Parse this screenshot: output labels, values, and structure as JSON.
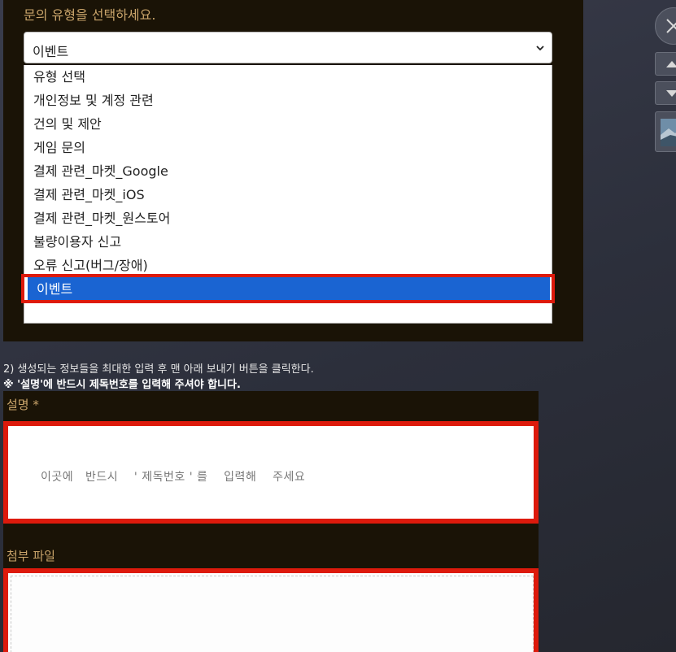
{
  "inquiry": {
    "type_prompt": "문의 유형을 선택하세요.",
    "selected_value": "이벤트",
    "options": [
      "유형 선택",
      "개인정보 및 계정 관련",
      "건의 및 제안",
      "게임 문의",
      "결제 관련_마켓_Google",
      "결제 관련_마켓_iOS",
      "결제 관련_마켓_원스토어",
      "불량이용자 신고",
      "오류 신고(버그/장애)",
      "이벤트"
    ],
    "selected_index": 9
  },
  "instructions": {
    "step2": "2) 생성되는 정보들을 최대한 입력 후 맨 아래 보내기 버튼을 클릭한다.",
    "note": "※ '설명'에 반드시 제독번호를 입력해 주셔야 합니다."
  },
  "form": {
    "description_label": "설명 *",
    "description_placeholder": "이곳에   반드시    ' 제독번호 ' 를    입력해    주세요",
    "attachment_label": "첨부 파일"
  },
  "colors": {
    "panel": "#1a1306",
    "label": "#c9a46a",
    "highlight": "#dd1a0c",
    "selected": "#1a64d2"
  },
  "icons": {
    "close": "close-icon",
    "up": "arrow-up-icon",
    "down": "arrow-down-icon",
    "dropdown": "chevron-down-icon",
    "thumbnail": "image-thumbnail"
  }
}
